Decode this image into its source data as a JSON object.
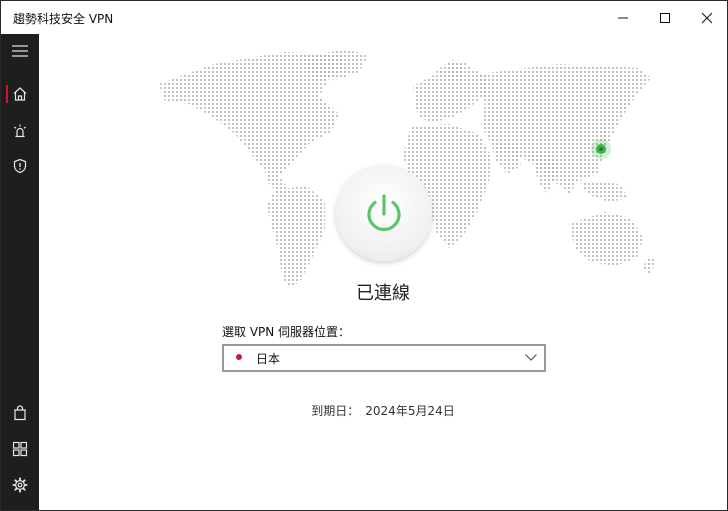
{
  "window": {
    "title": "趨勢科技安全 VPN",
    "controls": [
      "minimize-icon",
      "maximize-icon",
      "close-icon"
    ]
  },
  "sidebar": {
    "items": [
      {
        "name": "menu",
        "icon": "hamburger-menu-icon",
        "active": false
      },
      {
        "name": "home",
        "icon": "home-icon",
        "active": true
      },
      {
        "name": "alerts",
        "icon": "alert-siren-icon",
        "active": false
      },
      {
        "name": "security",
        "icon": "shield-icon",
        "active": false
      },
      {
        "name": "store",
        "icon": "shopping-bag-icon",
        "active": false
      },
      {
        "name": "apps",
        "icon": "grid-icon",
        "active": false
      },
      {
        "name": "settings",
        "icon": "gear-icon",
        "active": false
      }
    ],
    "accent_color": "#d0142c",
    "background": "#1e1e1e"
  },
  "main": {
    "connection_status": "已連線",
    "power_color": "#5cc46a",
    "location_marker_color": "#3cb44b",
    "server": {
      "label": "選取 VPN 伺服器位置：",
      "selected": "日本",
      "dot_color": "#b8243a"
    },
    "expiry": {
      "label": "到期日：",
      "date": "2024年5月24日"
    }
  }
}
